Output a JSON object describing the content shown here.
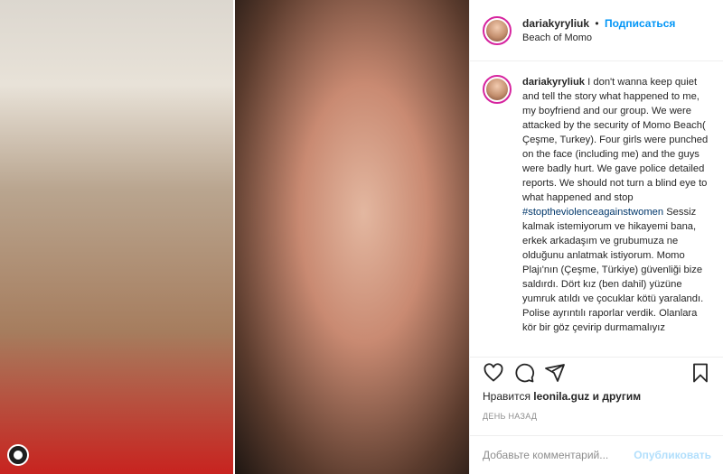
{
  "post": {
    "username": "dariakyryliuk",
    "follow_label": "Подписаться",
    "separator": "•",
    "location": "Beach of Momo"
  },
  "caption": {
    "username": "dariakyryliuk",
    "text_before": "I don't wanna keep quiet and tell the story what happened to me, my boyfriend and our group. We were attacked by the security of Momo Beach( Çeşme, Turkey). Four girls were punched on the face (including me) and the guys were badly hurt. We gave police detailed reports. We should not turn a blind eye to what happened and stop ",
    "hashtag": "#stoptheviolenceagainstwomen",
    "text_after": " Sessiz kalmak istemiyorum ve hikayemi bana, erkek arkadaşım ve grubumuza ne olduğunu anlatmak istiyorum. Momo Plajı'nın (Çeşme, Türkiye) güvenliği bize saldırdı. Dört kız (ben dahil) yüzüne yumruk atıldı ve çocuklar kötü yaralandı. Polise ayrıntılı raporlar verdik. Olanlara kör bir göz çevirip durmamalıyız"
  },
  "actions": {
    "like_icon": "heart-icon",
    "comment_icon": "comment-icon",
    "share_icon": "share-icon",
    "save_icon": "bookmark-icon"
  },
  "likes": {
    "prefix": "Нравится",
    "user": "leonila.guz",
    "suffix": "и другим"
  },
  "timestamp": "ДЕНЬ НАЗАД",
  "comment": {
    "placeholder": "Добавьте комментарий...",
    "publish_label": "Опубликовать"
  },
  "colors": {
    "accent": "#0095f6",
    "hashtag": "#00376b",
    "publish_disabled": "#b2dffc"
  }
}
